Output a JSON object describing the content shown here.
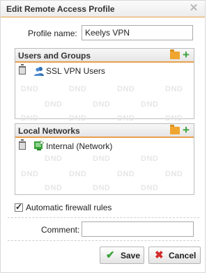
{
  "dialog": {
    "title": "Edit Remote Access Profile",
    "close_icon": "close-icon",
    "accent_color": "#e8a04a"
  },
  "profile": {
    "label": "Profile name:",
    "value": "Keelys VPN"
  },
  "users_panel": {
    "title": "Users and Groups",
    "items": [
      {
        "label": "SSL VPN Users",
        "icon": "users-group-icon"
      }
    ],
    "placeholder": "DND"
  },
  "networks_panel": {
    "title": "Local Networks",
    "items": [
      {
        "label": "Internal (Network)",
        "icon": "network-icon"
      }
    ],
    "placeholder": "DND"
  },
  "firewall": {
    "label": "Automatic firewall rules",
    "checked": true
  },
  "comment": {
    "label": "Comment:",
    "value": ""
  },
  "buttons": {
    "save": "Save",
    "cancel": "Cancel"
  }
}
